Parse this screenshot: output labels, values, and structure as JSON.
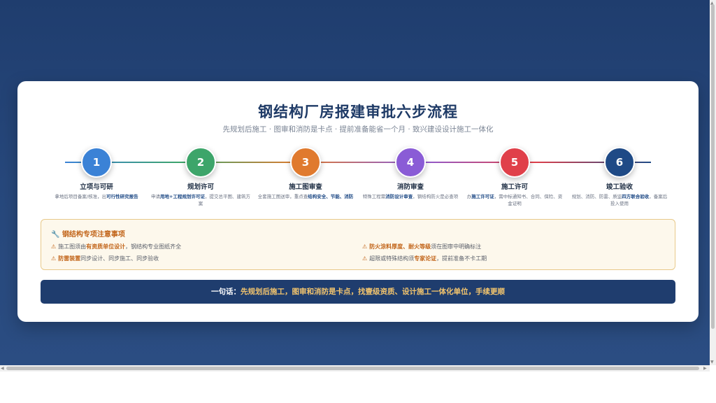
{
  "title": "钢结构厂房报建审批六步流程",
  "subtitle": "先规划后施工 · 图审和消防是卡点 · 提前准备能省一个月 · 致兴建设设计施工一体化",
  "steps": [
    {
      "num": "1",
      "title": "立项与可研",
      "color": "#3b82d6",
      "desc_pre": "拿地后项目备案/核准，出",
      "desc_hl": "可行性研究报告",
      "desc_post": ""
    },
    {
      "num": "2",
      "title": "规划许可",
      "color": "#3da56a",
      "desc_pre": "申请",
      "desc_hl": "用地+工程规划许可证",
      "desc_post": "，提交总平图、建筑方案"
    },
    {
      "num": "3",
      "title": "施工图审查",
      "color": "#e07a2e",
      "desc_pre": "全套施工图送审，重点查",
      "desc_hl": "结构安全、节能、消防",
      "desc_post": ""
    },
    {
      "num": "4",
      "title": "消防审查",
      "color": "#8a5cd6",
      "desc_pre": "特殊工程需",
      "desc_hl": "消防设计审查",
      "desc_post": "，钢结构防火是必查项"
    },
    {
      "num": "5",
      "title": "施工许可",
      "color": "#e0404a",
      "desc_pre": "办",
      "desc_hl": "施工许可证",
      "desc_post": "，需中标通知书、合同、保险、资金证明"
    },
    {
      "num": "6",
      "title": "竣工验收",
      "color": "#1f4a86",
      "desc_pre": "规划、消防、防雷、质监",
      "desc_hl": "四方联合验收",
      "desc_post": "，备案后投入使用"
    }
  ],
  "notice": {
    "title": "🔧 钢结构专项注意事项",
    "items": [
      {
        "pre": "施工图须由",
        "hl": "有资质单位设计",
        "post": "，钢结构专业图纸齐全"
      },
      {
        "pre": "",
        "hl": "防火涂料厚度、耐火等级",
        "post": "须在图审中明确标注"
      },
      {
        "pre": "",
        "hl": "防雷装置",
        "post": "同步设计、同步施工、同步验收"
      },
      {
        "pre": "超限或特殊结构须",
        "hl": "专家论证",
        "post": "，提前准备不卡工期"
      }
    ]
  },
  "banner": {
    "prefix": "一句话：",
    "text": "先规划后施工，图审和消防是卡点，找壹级资质、设计施工一体化单位，手续更顺"
  },
  "warn_icon": "warning-icon"
}
